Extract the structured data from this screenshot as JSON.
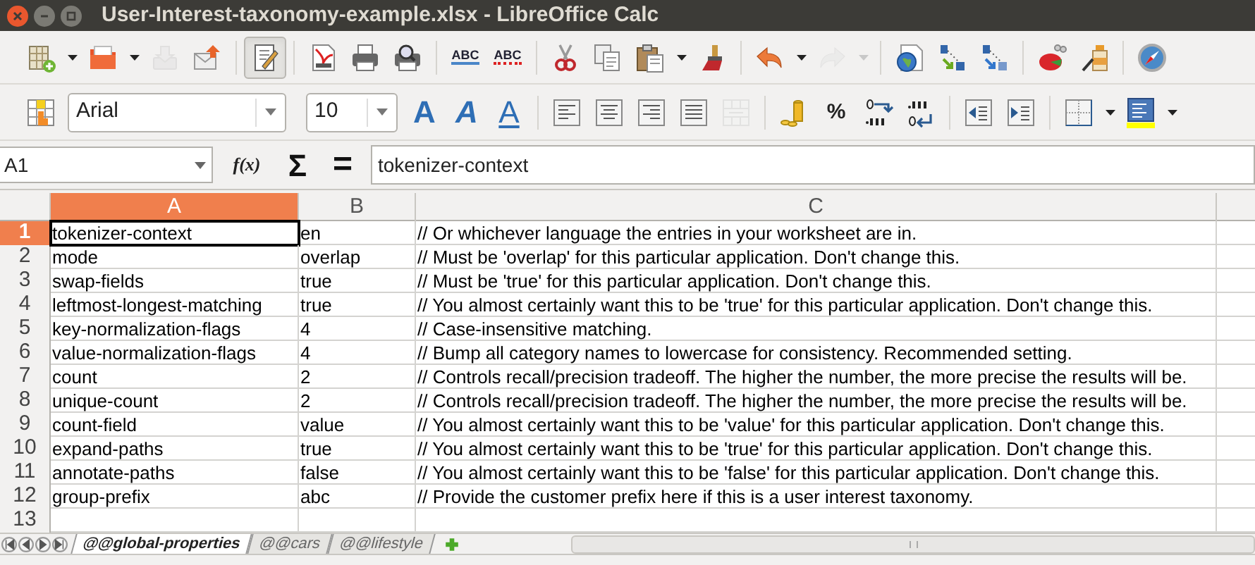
{
  "window": {
    "title": "User-Interest-taxonomy-example.xlsx - LibreOffice Calc"
  },
  "standard_toolbar": [
    {
      "kind": "new-sheet",
      "disabled": false,
      "on": false
    },
    {
      "kind": "dropdown",
      "disabled": false
    },
    {
      "kind": "folder",
      "disabled": false,
      "on": false
    },
    {
      "kind": "dropdown",
      "disabled": false
    },
    {
      "kind": "save",
      "disabled": true,
      "on": false
    },
    {
      "kind": "mail",
      "disabled": false,
      "on": false
    },
    {
      "kind": "separator"
    },
    {
      "kind": "edit",
      "disabled": false,
      "on": true
    },
    {
      "kind": "separator"
    },
    {
      "kind": "pdf",
      "disabled": false,
      "on": false
    },
    {
      "kind": "printer",
      "disabled": false,
      "on": false
    },
    {
      "kind": "preview",
      "disabled": false,
      "on": false
    },
    {
      "kind": "separator"
    },
    {
      "kind": "spell",
      "label": "ABC",
      "disabled": false,
      "on": false
    },
    {
      "kind": "autospell",
      "label": "ABC",
      "disabled": false,
      "on": false
    },
    {
      "kind": "separator"
    },
    {
      "kind": "scissors",
      "disabled": false,
      "on": false
    },
    {
      "kind": "copy",
      "disabled": false,
      "on": false
    },
    {
      "kind": "paste",
      "disabled": false,
      "on": false
    },
    {
      "kind": "dropdown",
      "disabled": false
    },
    {
      "kind": "brush",
      "disabled": false,
      "on": false
    },
    {
      "kind": "separator"
    },
    {
      "kind": "undo",
      "disabled": false,
      "on": false
    },
    {
      "kind": "dropdown",
      "disabled": false
    },
    {
      "kind": "redo",
      "disabled": true,
      "on": false
    },
    {
      "kind": "dropdown",
      "disabled": true
    },
    {
      "kind": "separator"
    },
    {
      "kind": "globe",
      "disabled": false,
      "on": false
    },
    {
      "kind": "sort-asc",
      "disabled": false,
      "on": false
    },
    {
      "kind": "sort-desc",
      "disabled": false,
      "on": false
    },
    {
      "kind": "separator"
    },
    {
      "kind": "chart",
      "disabled": false,
      "on": false
    },
    {
      "kind": "draw",
      "disabled": false,
      "on": false
    },
    {
      "kind": "separator"
    },
    {
      "kind": "compass",
      "disabled": false,
      "on": false
    }
  ],
  "formatting_toolbar": [
    {
      "kind": "sidebar",
      "disabled": false
    },
    {
      "kind": "font-name",
      "value": "Arial",
      "disabled": false
    },
    {
      "kind": "font-size",
      "value": "10",
      "disabled": false
    },
    {
      "kind": "bold",
      "label": "A",
      "disabled": false
    },
    {
      "kind": "italic",
      "label": "A",
      "disabled": false
    },
    {
      "kind": "underline",
      "label": "A",
      "disabled": false
    },
    {
      "kind": "separator"
    },
    {
      "kind": "align-left",
      "disabled": false
    },
    {
      "kind": "align-center",
      "disabled": false
    },
    {
      "kind": "align-right",
      "disabled": false
    },
    {
      "kind": "justify",
      "disabled": false
    },
    {
      "kind": "merge",
      "disabled": true
    },
    {
      "kind": "separator"
    },
    {
      "kind": "coins",
      "disabled": false
    },
    {
      "kind": "percent",
      "label": "%",
      "disabled": false
    },
    {
      "kind": "add-decimal",
      "disabled": false
    },
    {
      "kind": "del-decimal",
      "disabled": false
    },
    {
      "kind": "separator"
    },
    {
      "kind": "outdent",
      "disabled": false
    },
    {
      "kind": "indent",
      "disabled": false
    },
    {
      "kind": "separator"
    },
    {
      "kind": "borders",
      "disabled": false
    },
    {
      "kind": "dropdown",
      "disabled": false
    },
    {
      "kind": "highlight",
      "disabled": false
    },
    {
      "kind": "dropdown",
      "disabled": false
    }
  ],
  "formula_bar": {
    "name_box": "A1",
    "function_wizard": "f(x)",
    "sum": "Σ",
    "equals": "=",
    "content": "tokenizer-context"
  },
  "columns": [
    {
      "label": "A",
      "selected": true
    },
    {
      "label": "B",
      "selected": false
    },
    {
      "label": "C",
      "selected": false
    }
  ],
  "rows": [
    {
      "number": "1",
      "selected": true,
      "cells": [
        {
          "text": "tokenizer-context",
          "active": true
        },
        {
          "text": "en",
          "active": false
        },
        {
          "text": "// Or whichever language the entries in your worksheet are in.",
          "active": false
        }
      ]
    },
    {
      "number": "2",
      "selected": false,
      "cells": [
        {
          "text": "mode",
          "active": false
        },
        {
          "text": "overlap",
          "active": false
        },
        {
          "text": "// Must be 'overlap' for this particular application. Don't change this.",
          "active": false
        }
      ]
    },
    {
      "number": "3",
      "selected": false,
      "cells": [
        {
          "text": "swap-fields",
          "active": false
        },
        {
          "text": "true",
          "active": false
        },
        {
          "text": "// Must be 'true' for this particular application. Don't change this.",
          "active": false
        }
      ]
    },
    {
      "number": "4",
      "selected": false,
      "cells": [
        {
          "text": "leftmost-longest-matching",
          "active": false
        },
        {
          "text": "true",
          "active": false
        },
        {
          "text": "// You almost certainly want this to be 'true' for this particular application. Don't change this.",
          "active": false
        }
      ]
    },
    {
      "number": "5",
      "selected": false,
      "cells": [
        {
          "text": "key-normalization-flags",
          "active": false
        },
        {
          "text": "4",
          "active": false
        },
        {
          "text": "// Case-insensitive matching.",
          "active": false
        }
      ]
    },
    {
      "number": "6",
      "selected": false,
      "cells": [
        {
          "text": "value-normalization-flags",
          "active": false
        },
        {
          "text": "4",
          "active": false
        },
        {
          "text": "// Bump all category names to lowercase for consistency. Recommended setting.",
          "active": false
        }
      ]
    },
    {
      "number": "7",
      "selected": false,
      "cells": [
        {
          "text": "count",
          "active": false
        },
        {
          "text": "2",
          "active": false
        },
        {
          "text": "// Controls recall/precision tradeoff. The higher the number, the more precise the results will be.",
          "active": false
        }
      ]
    },
    {
      "number": "8",
      "selected": false,
      "cells": [
        {
          "text": "unique-count",
          "active": false
        },
        {
          "text": "2",
          "active": false
        },
        {
          "text": "// Controls recall/precision tradeoff. The higher the number, the more precise the results will be.",
          "active": false
        }
      ]
    },
    {
      "number": "9",
      "selected": false,
      "cells": [
        {
          "text": "count-field",
          "active": false
        },
        {
          "text": "value",
          "active": false
        },
        {
          "text": "// You almost certainly want this to be 'value' for this particular application. Don't change this.",
          "active": false
        }
      ]
    },
    {
      "number": "10",
      "selected": false,
      "cells": [
        {
          "text": "expand-paths",
          "active": false
        },
        {
          "text": "true",
          "active": false
        },
        {
          "text": "// You almost certainly want this to be 'true' for this particular application. Don't change this.",
          "active": false
        }
      ]
    },
    {
      "number": "11",
      "selected": false,
      "cells": [
        {
          "text": "annotate-paths",
          "active": false
        },
        {
          "text": "false",
          "active": false
        },
        {
          "text": "// You almost certainly want this to be 'false' for this particular application. Don't change this.",
          "active": false
        }
      ]
    },
    {
      "number": "12",
      "selected": false,
      "cells": [
        {
          "text": "group-prefix",
          "active": false
        },
        {
          "text": "abc",
          "active": false
        },
        {
          "text": "// Provide the customer prefix here if this is a user interest taxonomy.",
          "active": false
        }
      ]
    },
    {
      "number": "13",
      "selected": false,
      "cells": []
    }
  ],
  "sheet_tabs": [
    {
      "label": "@@global-properties",
      "selected": true
    },
    {
      "label": "@@cars",
      "selected": false
    },
    {
      "label": "@@lifestyle",
      "selected": false
    }
  ]
}
